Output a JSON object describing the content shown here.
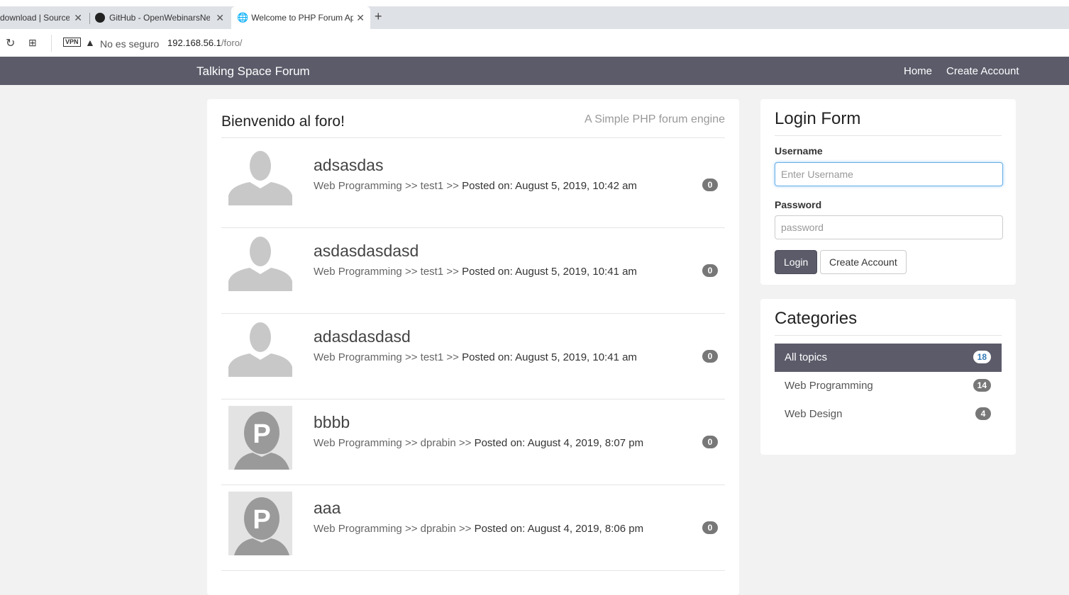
{
  "browser": {
    "tabs": [
      {
        "label": "download | SourceF",
        "active": false
      },
      {
        "label": "GitHub - OpenWebinarsNe",
        "active": false
      },
      {
        "label": "Welcome to PHP Forum Ap",
        "active": true
      }
    ],
    "security_label": "No es seguro",
    "vpn_label": "VPN",
    "url_host": "192.168.56.1",
    "url_path": "/foro/"
  },
  "navbar": {
    "brand": "Talking Space Forum",
    "links": [
      "Home",
      "Create Account"
    ]
  },
  "main": {
    "title": "Bienvenido al foro!",
    "tagline": "A Simple PHP forum engine",
    "topics": [
      {
        "title": "adsasdas",
        "category": "Web Programming",
        "user": "test1",
        "posted_label": "Posted on:",
        "date": "August 5, 2019, 10:42 am",
        "replies": "0",
        "avatar": "default"
      },
      {
        "title": "asdasdasdasd",
        "category": "Web Programming",
        "user": "test1",
        "posted_label": "Posted on:",
        "date": "August 5, 2019, 10:41 am",
        "replies": "0",
        "avatar": "default"
      },
      {
        "title": "adasdasdasd",
        "category": "Web Programming",
        "user": "test1",
        "posted_label": "Posted on:",
        "date": "August 5, 2019, 10:41 am",
        "replies": "0",
        "avatar": "default"
      },
      {
        "title": "bbbb",
        "category": "Web Programming",
        "user": "dprabin",
        "posted_label": "Posted on:",
        "date": "August 4, 2019, 8:07 pm",
        "replies": "0",
        "avatar": "P"
      },
      {
        "title": "aaa",
        "category": "Web Programming",
        "user": "dprabin",
        "posted_label": "Posted on:",
        "date": "August 4, 2019, 8:06 pm",
        "replies": "0",
        "avatar": "P"
      }
    ],
    "separator": ">>"
  },
  "login": {
    "title": "Login Form",
    "username_label": "Username",
    "username_placeholder": "Enter Username",
    "password_label": "Password",
    "password_placeholder": "password",
    "login_button": "Login",
    "create_button": "Create Account"
  },
  "categories": {
    "title": "Categories",
    "items": [
      {
        "label": "All topics",
        "count": "18",
        "active": true
      },
      {
        "label": "Web Programming",
        "count": "14",
        "active": false
      },
      {
        "label": "Web Design",
        "count": "4",
        "active": false
      }
    ]
  },
  "colors": {
    "navbar": "#5b5b6a",
    "background": "#f2f2f2",
    "badge": "#777777",
    "accent_link": "#337ab7"
  }
}
